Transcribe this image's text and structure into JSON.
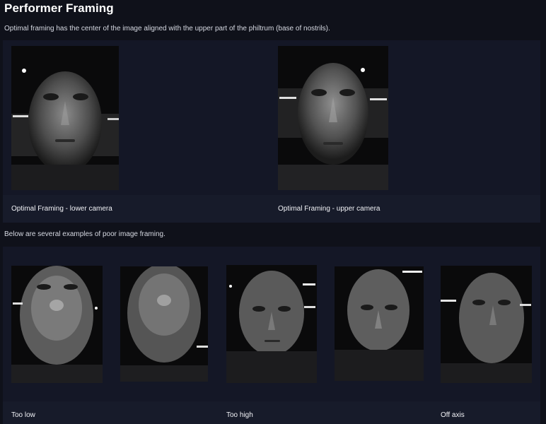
{
  "page": {
    "title": "Performer Framing",
    "intro": "Optimal framing has the center of the image aligned with the upper part of the philtrum (base of nostrils).",
    "poor_intro": "Below are several examples of poor image framing."
  },
  "optimal": {
    "items": [
      {
        "caption": "Optimal Framing - lower camera",
        "icon": "face-photo-icon"
      },
      {
        "caption": "Optimal Framing - upper camera",
        "icon": "face-photo-icon"
      }
    ]
  },
  "poor": {
    "items": [
      {
        "caption": "Too low",
        "icon": "face-photo-icon"
      },
      {
        "caption": "",
        "icon": "face-photo-icon"
      },
      {
        "caption": "Too high",
        "icon": "face-photo-icon"
      },
      {
        "caption": "",
        "icon": "face-photo-icon"
      },
      {
        "caption": "Off axis",
        "icon": "face-photo-icon"
      }
    ]
  },
  "colors": {
    "background": "#0f111a",
    "panel": "#141726",
    "caption_band": "#171b2a",
    "text": "#e6e8ee"
  }
}
